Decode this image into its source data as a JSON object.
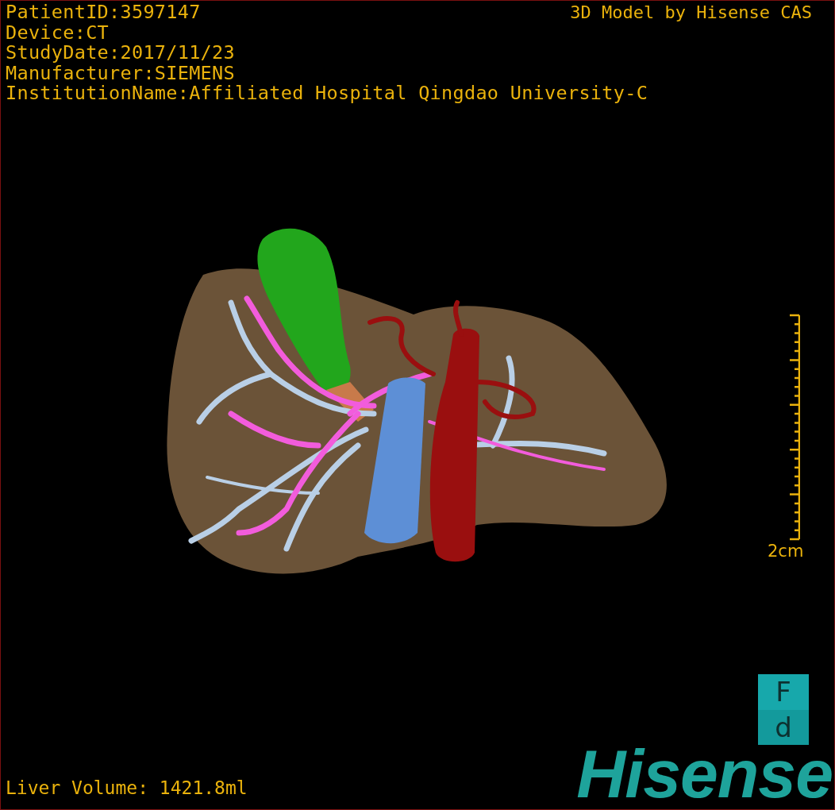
{
  "patient_info": [
    "PatientID:3597147",
    "Device:CT",
    "StudyDate:2017/11/23",
    "Manufacturer:SIEMENS",
    "InstitutionName:Affiliated Hospital Qingdao University-C"
  ],
  "title": "3D Model by Hisense CAS",
  "scale_bar": {
    "label": "2cm"
  },
  "orientation_cube": {
    "top_face": "F",
    "front_face": "d"
  },
  "liver_volume": "Liver Volume: 1421.8ml",
  "logo": "Hisense"
}
